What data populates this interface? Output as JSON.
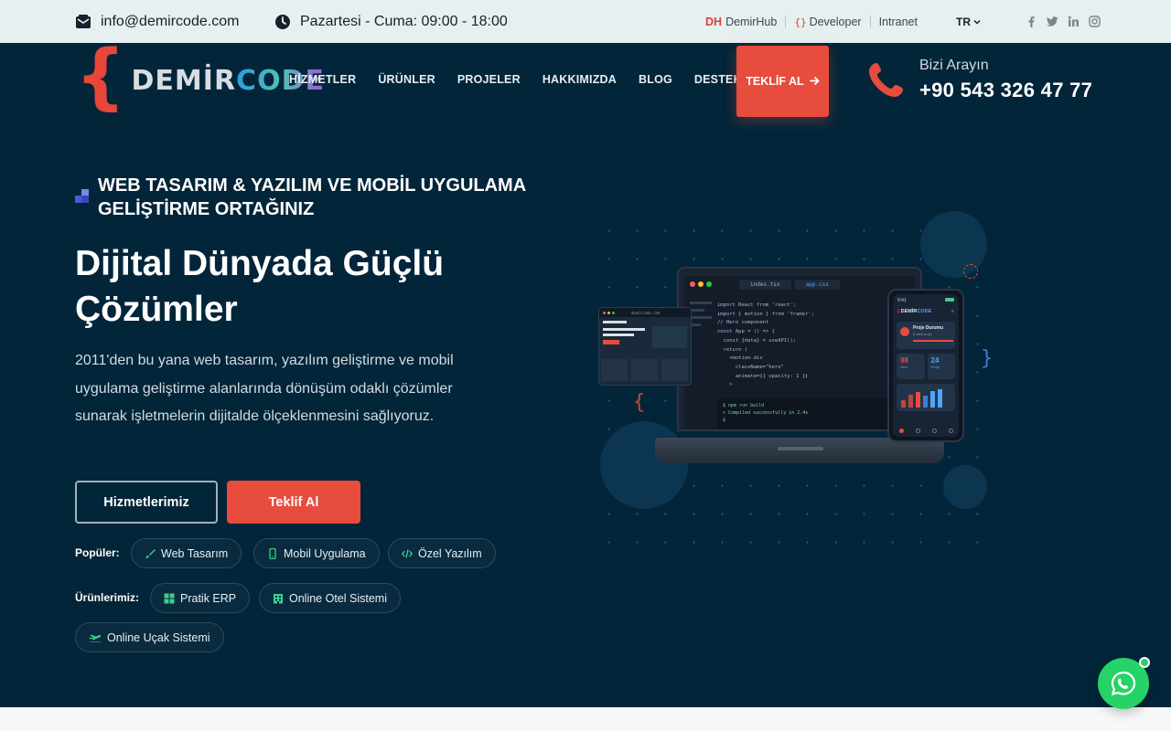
{
  "topbar": {
    "email": "info@demircode.com",
    "hours": "Pazartesi - Cuma: 09:00 - 18:00",
    "links": {
      "demirhub_prefix": "DH",
      "demirhub": "DemirHub",
      "developer_prefix": "{}",
      "developer": "Developer",
      "intranet": "Intranet"
    },
    "language": "TR",
    "social": [
      "facebook-icon",
      "twitter-icon",
      "linkedin-icon",
      "instagram-icon"
    ]
  },
  "header": {
    "logo_brace": "{",
    "logo_part1": "DEMİR",
    "logo_part2": "CODE",
    "nav": [
      "HİZMETLER",
      "ÜRÜNLER",
      "PROJELER",
      "HAKKIMIZDA",
      "BLOG",
      "DESTEK"
    ],
    "cta": "TEKLİF AL",
    "phone_label": "Bizi Arayın",
    "phone_number": "+90 543 326 47 77"
  },
  "hero": {
    "eyebrow": "WEB TASARIM & YAZILIM VE MOBİL UYGULAMA GELİŞTİRME ORTAĞINIZ",
    "title": "Dijital Dünyada Güçlü Çözümler",
    "description": "2011'den bu yana web tasarım, yazılım geliştirme ve mobil uygulama geliştirme alanlarında dönüşüm odaklı çözümler sunarak işletmelerin dijitalde ölçeklenmesini sağlıyoruz.",
    "btn_services": "Hizmetlerimiz",
    "btn_quote": "Teklif Al",
    "popular_label": "Popüler:",
    "popular": [
      "Web Tasarım",
      "Mobil Uygulama",
      "Özel Yazılım"
    ],
    "products_label": "Ürünlerimiz:",
    "products": [
      "Pratik ERP",
      "Online Otel Sistemi",
      "Online Uçak Sistemi"
    ]
  },
  "illustration": {
    "tabs": [
      "index.tsx",
      "app.css"
    ],
    "code": "import React from 'react';\nimport { motion } from 'framer';\n// Hero component\nconst App = () => {\n  const {data} = useAPI();\n  return (\n    <motion.div\n      className=\"hero\"\n      animate={{ opacity: 1 }}\n    >",
    "terminal": "$ npm run build\n> Compiled successfully in 2.4s\n$",
    "phone_brand_part1": "DEMİR",
    "phone_brand_part2": "CODE",
    "phone_card_title": "Proje Durumu",
    "phone_card_sub": "5 aktif proje",
    "stat1_value": "98",
    "stat1_label": "Skor",
    "stat2_value": "24",
    "stat2_label": "Proje",
    "phone_time": "9:41",
    "mini_url": "demircode.com"
  },
  "colors": {
    "accent": "#e84c3d",
    "hero_bg": "#032539",
    "topbar_bg": "#e6f0f1",
    "whatsapp": "#25d366"
  }
}
